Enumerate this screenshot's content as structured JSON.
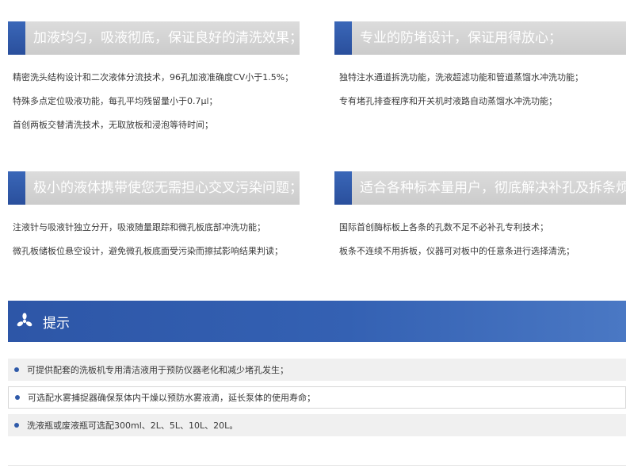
{
  "features": [
    {
      "title": "加液均匀，吸液彻底，保证良好的清洗效果；",
      "items": [
        "精密洗头结构设计和二次液体分流技术，96孔加液准确度CV小于1.5%；",
        "特殊多点定位吸液功能，每孔平均残留量小于0.7μl；",
        "首创两板交替清洗技术，无取放板和浸泡等待时间；"
      ]
    },
    {
      "title": "专业的防堵设计，保证用得放心；",
      "items": [
        "独特注水通道拆洗功能，洗液超滤功能和管道蒸馏水冲洗功能；",
        "专有堵孔排查程序和开关机时液路自动蒸馏水冲洗功能；"
      ]
    },
    {
      "title": "极小的液体携带使您无需担心交叉污染问题；",
      "items": [
        "注液针与吸液针独立分开，吸液随量跟踪和微孔板底部冲洗功能；",
        "微孔板储板位悬空设计，避免微孔板底面受污染而擦拭影响结果判读；"
      ]
    },
    {
      "title": "适合各种标本量用户，彻底解决补孔及拆条烦恼；",
      "items": [
        "国际首创酶标板上各条的孔数不足不必补孔专利技术；",
        "板条不连续不用拆板，仪器可对板中的任意条进行选择清洗；"
      ]
    }
  ],
  "tips": {
    "title": "提示",
    "icon": "pinwheel-icon",
    "items": [
      "可提供配套的洗板机专用清洁液用于预防仪器老化和减少堵孔发生；",
      "可选配水雾捕捉器确保泵体内干燥以预防水雾液滴，延长泵体的使用寿命；",
      "洗液瓶或废液瓶可选配300ml、2L、5L、10L、20L。"
    ]
  },
  "colors": {
    "accent_blue": "#2d56a7",
    "header_gray": "#d3d3d3",
    "bullet_blue": "#2f5aa9"
  }
}
